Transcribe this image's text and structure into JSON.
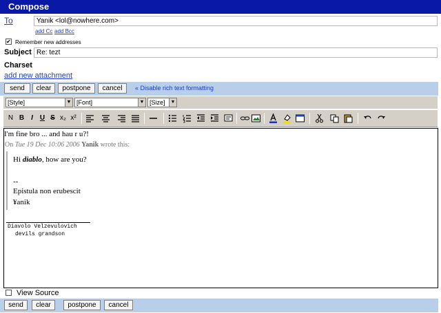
{
  "header": {
    "title": "Compose"
  },
  "to": {
    "label": "To",
    "value": "Yanik <lol@nowhere.com>",
    "add_cc": "add Cc",
    "add_bcc": "add Bcc"
  },
  "remember": {
    "label": "Remember new addresses",
    "checked": true,
    "mark": "✔"
  },
  "subject": {
    "label": "Subject",
    "value": "Re: tezt"
  },
  "charset": {
    "label": "Charset"
  },
  "attachment": {
    "label": "add new attachment"
  },
  "buttons": {
    "send": "send",
    "clear": "clear",
    "postpone": "postpone",
    "cancel": "cancel"
  },
  "disable_rich": "« Disable rich text formatting",
  "format": {
    "style": "[Style]",
    "font": "[Font]",
    "size": "[Size]"
  },
  "toolbar": {
    "bold": "B",
    "italic": "I",
    "underline": "U",
    "strike": "S",
    "subscript": "x₂",
    "superscript": "x²",
    "normal": "N"
  },
  "editor": {
    "line1": "I'm fine bro ... and hau r u?!",
    "wrote_prefix": "On ",
    "wrote_date": "Tue 19 Dec 10:06 2006",
    "wrote_name": "Yanik",
    "wrote_suffix": " wrote this:",
    "quote_hi": "Hi ",
    "quote_name": "diablo",
    "quote_rest": ", how are you?",
    "quote_dashes": "--",
    "quote_sig1": "Epistula non erubescit",
    "quote_sig2": "¥anik",
    "signature_line1": "Diavolo Velzevulovich",
    "signature_line2": "devils grandson"
  },
  "view_source": {
    "label": "View Source",
    "checked": false
  },
  "colors": {
    "title_bar": "#0a18a8",
    "button_bar": "#b9cfe9",
    "link": "#1a3fcc",
    "toolbar": "#d4d0c8"
  }
}
